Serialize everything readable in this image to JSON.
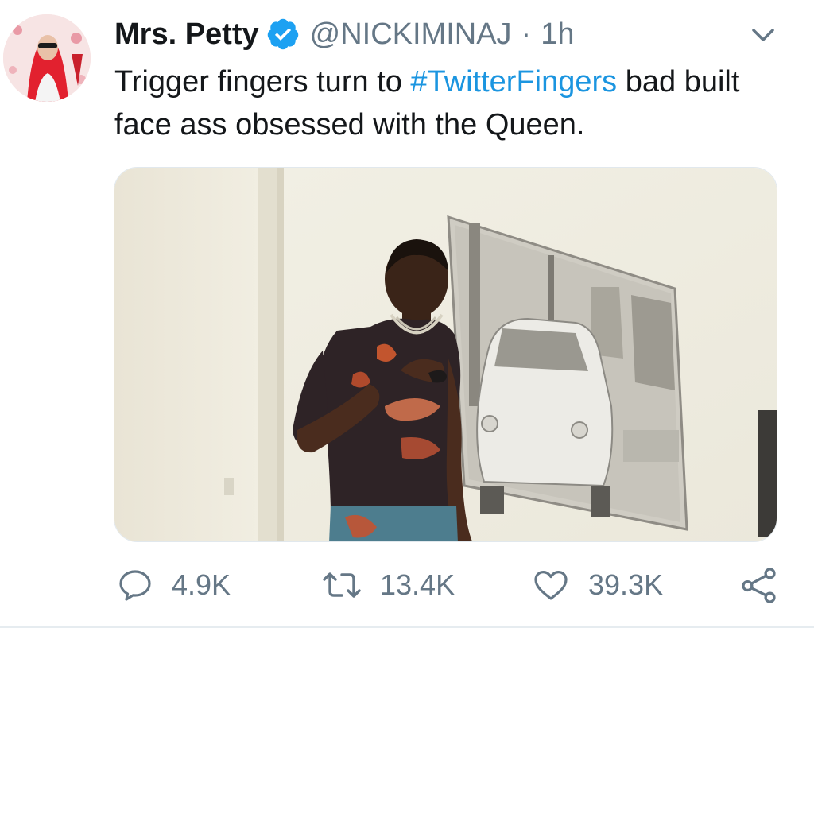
{
  "tweet": {
    "display_name": "Mrs. Petty",
    "handle": "@NICKIMINAJ",
    "separator": "·",
    "time": "1h",
    "text_before": "Trigger fingers turn to ",
    "hashtag": "#TwitterFingers",
    "text_after": " bad built face ass obsessed with the Queen.",
    "verified_icon": "verified-badge-icon",
    "menu_icon": "chevron-down-icon"
  },
  "actions": {
    "reply_count": "4.9K",
    "retweet_count": "13.4K",
    "like_count": "39.3K"
  },
  "colors": {
    "link": "#1b95e0",
    "secondary_text": "#657786",
    "verified": "#1da1f2",
    "divider": "#e6ecf0"
  }
}
